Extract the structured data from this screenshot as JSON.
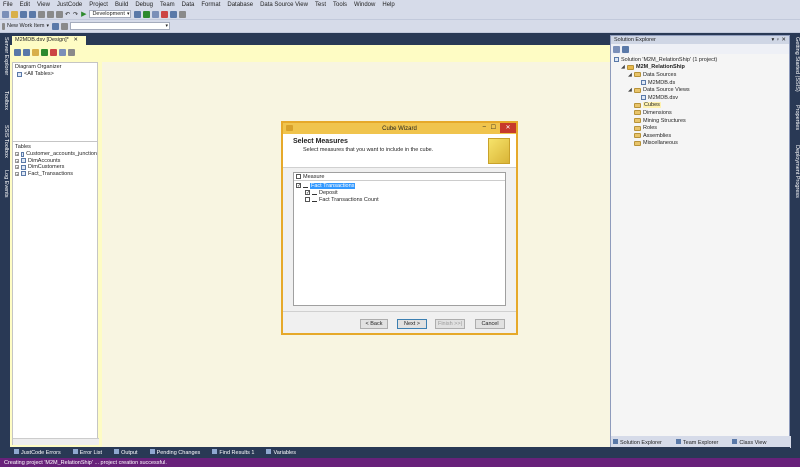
{
  "menu": [
    "File",
    "Edit",
    "View",
    "JustCode",
    "Project",
    "Build",
    "Debug",
    "Team",
    "Data",
    "Format",
    "Database",
    "Data Source View",
    "Test",
    "Tools",
    "Window",
    "Help"
  ],
  "toolbar": {
    "config_value": "Development",
    "new_work_item": "New Work Item"
  },
  "left_strip": [
    "Server Explorer",
    "Toolbox",
    "SSIS Toolbox",
    "Log Events"
  ],
  "right_strip": [
    "Getting Started (SSIS)",
    "Properties",
    "Deployment Progress"
  ],
  "document": {
    "tab_label": "M2MDB.dsv [Design]*",
    "diagram_organizer": "Diagram Organizer",
    "all_tables": "<All Tables>",
    "tables_header": "Tables",
    "tables": [
      "Customer_accounts_junction",
      "DimAccounts",
      "DimCustomers",
      "Fact_Transactions"
    ]
  },
  "solution_explorer": {
    "title": "Solution Explorer",
    "pin": "▾ ♀ ✕",
    "items": [
      {
        "label": "Solution 'M2M_RelationShip' (1 project)",
        "level": 0,
        "kind": "solution"
      },
      {
        "label": "M2M_RelationShip",
        "level": 1,
        "kind": "project"
      },
      {
        "label": "Data Sources",
        "level": 2,
        "kind": "folder"
      },
      {
        "label": "M2MDB.ds",
        "level": 3,
        "kind": "file"
      },
      {
        "label": "Data Source Views",
        "level": 2,
        "kind": "folder"
      },
      {
        "label": "M2MDB.dsv",
        "level": 3,
        "kind": "file"
      },
      {
        "label": "Cubes",
        "level": 2,
        "kind": "folder"
      },
      {
        "label": "Dimensions",
        "level": 2,
        "kind": "folder"
      },
      {
        "label": "Mining Structures",
        "level": 2,
        "kind": "folder"
      },
      {
        "label": "Roles",
        "level": 2,
        "kind": "folder"
      },
      {
        "label": "Assemblies",
        "level": 2,
        "kind": "folder"
      },
      {
        "label": "Miscellaneous",
        "level": 2,
        "kind": "folder"
      }
    ],
    "bottom_tabs": [
      "Solution Explorer",
      "Team Explorer",
      "Class View"
    ]
  },
  "wizard": {
    "title": "Cube Wizard",
    "heading": "Select Measures",
    "subheading": "Select measures that you want to include in the cube.",
    "column_header": "Measure",
    "rows": [
      {
        "label": "Fact Transactions",
        "level": 0,
        "checked": true,
        "selected": true
      },
      {
        "label": "Deposit",
        "level": 1,
        "checked": true,
        "selected": false
      },
      {
        "label": "Fact Transactions Count",
        "level": 1,
        "checked": false,
        "selected": false
      }
    ],
    "buttons": {
      "back": "< Back",
      "next": "Next >",
      "finish": "Finish >>|",
      "cancel": "Cancel"
    }
  },
  "bottom_tabs": [
    "JustCode Errors",
    "Error List",
    "Output",
    "Pending Changes",
    "Find Results 1",
    "Variables"
  ],
  "status": "Creating project 'M2M_RelationShip' ... project creation successful.",
  "colors": {
    "accent": "#68217a",
    "chrome": "#293955",
    "designer_bg": "#fefcc4",
    "wizard_border": "#e6a92a"
  }
}
